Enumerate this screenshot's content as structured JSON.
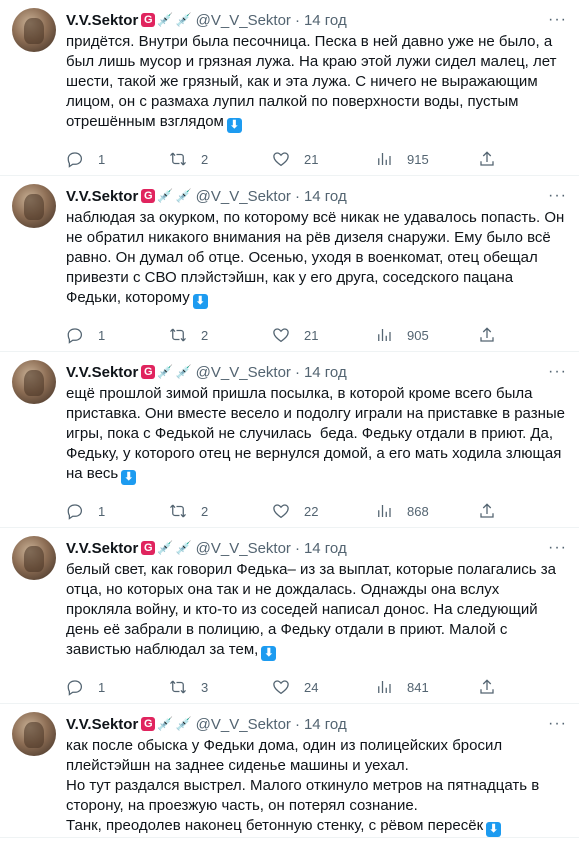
{
  "author": {
    "name": "V.V.Sektor",
    "handle": "@V_V_Sektor",
    "dot": "·"
  },
  "tweets": [
    {
      "time": "14 год",
      "text": "придётся. Внутри была песочница. Песка в ней давно уже не было, а был лишь мусор и грязная лужа. На краю этой лужи сидел малец, лет шести, такой же грязный, как и эта лужа. С ничего не выражающим лицом, он с размаха лупил палкой по поверхности воды, пустым отрешённым взглядом",
      "replies": "1",
      "retweets": "2",
      "likes": "21",
      "views": "915"
    },
    {
      "time": "14 год",
      "text": "наблюдая за окурком, по которому всё никак не удавалось попасть. Он не обратил никакого внимания на рёв дизеля снаружи. Ему было всё равно. Он думал об отце. Осенью, уходя в военкомат, отец обещал привезти с СВО плэйстэйшн, как у его друга, соседского пацана Федьки, которому",
      "replies": "1",
      "retweets": "2",
      "likes": "21",
      "views": "905"
    },
    {
      "time": "14 год",
      "text": "ещё прошлой зимой пришла посылка, в которой кроме всего была приставка. Они вместе весело и подолгу играли на приставке в разные игры, пока с Федькой не случилась  беда. Федьку отдали в приют. Да, Федьку, у которого отец не вернулся домой, а его мать ходила злющая на весь",
      "replies": "1",
      "retweets": "2",
      "likes": "22",
      "views": "868"
    },
    {
      "time": "14 год",
      "text": "белый свет, как говорил Федька– из за выплат, которые полагались за отца, но которых она так и не дождалась. Однажды она вслух прокляла войну, и кто-то из соседей написал донос. На следующий день её забрали в полицию, а Федьку отдали в приют. Малой с завистью наблюдал за тем,",
      "replies": "1",
      "retweets": "3",
      "likes": "24",
      "views": "841"
    },
    {
      "time": "14 год",
      "text": "как после обыска у Федьки дома, один из полицейских бросил плейстэйшн на заднее сиденье машины и уехал.\nНо тут раздался выстрел. Малого откинуло метров на пятнадцать в сторону, на проезжую часть, он потерял сознание.\nТанк, преодолев наконец бетонную стенку, с рёвом пересёк"
    }
  ]
}
